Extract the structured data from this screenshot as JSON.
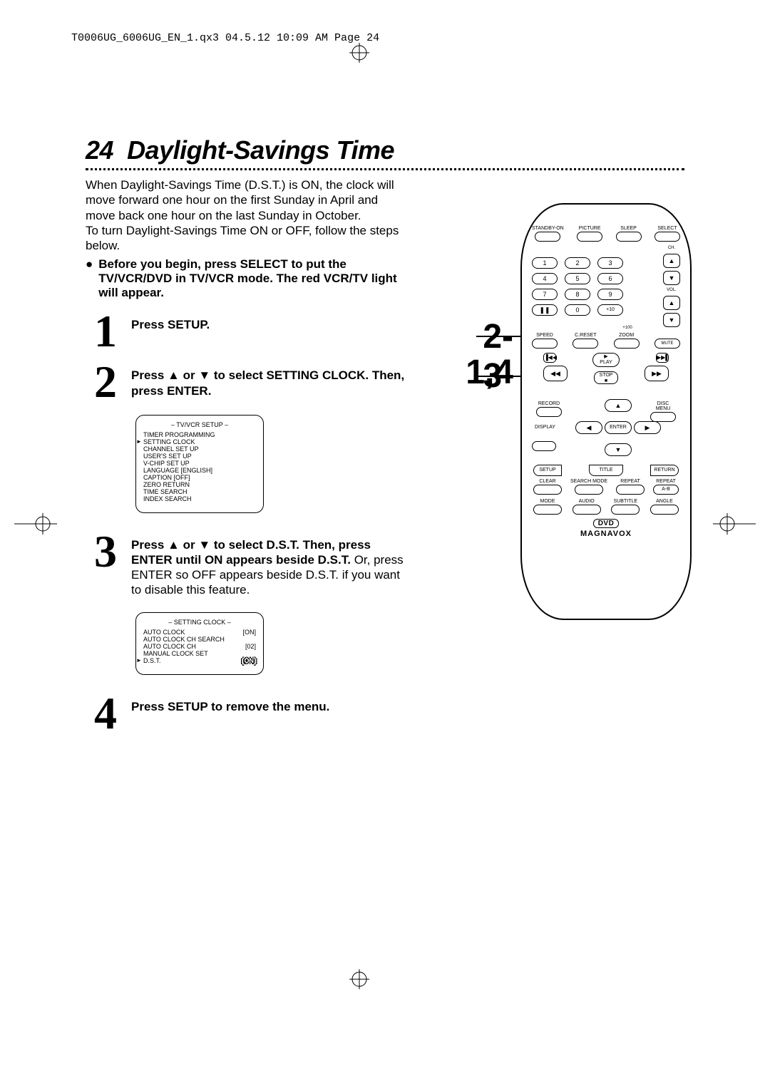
{
  "header": "T0006UG_6006UG_EN_1.qx3  04.5.12  10:09 AM  Page 24",
  "page_number": "24",
  "title": "Daylight-Savings Time",
  "intro": "When Daylight-Savings Time (D.S.T.) is ON, the clock will move forward one hour on the first Sunday in April and move back one hour on the last Sunday in October.\nTo turn Daylight-Savings Time ON or OFF, follow the steps below.",
  "bullet": "Before you begin, press SELECT to put the TV/VCR/DVD in TV/VCR mode. The red VCR/TV light will appear.",
  "steps": {
    "s1": {
      "num": "1",
      "body_bold": "Press SETUP."
    },
    "s2": {
      "num": "2",
      "body_bold": "Press ▲ or ▼ to select SETTING CLOCK. Then, press ENTER."
    },
    "s3": {
      "num": "3",
      "body_bold": "Press ▲ or ▼ to select D.S.T. Then, press ENTER until ON appears beside D.S.T. ",
      "body_rest": "Or, press ENTER so OFF appears beside D.S.T. if you want to disable this feature."
    },
    "s4": {
      "num": "4",
      "body_bold": "Press SETUP to remove the menu."
    }
  },
  "osd1": {
    "title": "– TV/VCR SETUP –",
    "items": [
      "TIMER PROGRAMMING",
      "SETTING CLOCK",
      "CHANNEL SET UP",
      "USER'S SET UP",
      "V-CHIP SET UP",
      "LANGUAGE   [ENGLISH]",
      "CAPTION   [OFF]",
      "ZERO RETURN",
      "TIME SEARCH",
      "INDEX SEARCH"
    ],
    "pointer_index": 1
  },
  "osd2": {
    "title": "– SETTING CLOCK –",
    "rows": [
      {
        "l": "AUTO CLOCK",
        "r": "[ON]"
      },
      {
        "l": "AUTO CLOCK CH SEARCH",
        "r": ""
      },
      {
        "l": "AUTO CLOCK CH",
        "r": "[02]"
      },
      {
        "l": "MANUAL CLOCK SET",
        "r": ""
      },
      {
        "l": "D.S.T.",
        "r": "[ON]"
      }
    ],
    "pointer_index": 4
  },
  "callouts": {
    "top": "2-3",
    "bot": "1,4"
  },
  "remote": {
    "row1": [
      "STANDBY-ON",
      "PICTURE",
      "SLEEP",
      "SELECT"
    ],
    "nums": [
      "1",
      "2",
      "3",
      "4",
      "5",
      "6",
      "7",
      "8",
      "9",
      "",
      "0",
      "+10"
    ],
    "pause_label": "❚❚",
    "plus100": "+100",
    "ch": "CH.",
    "vol": "VOL.",
    "row_speed": [
      "SPEED",
      "C.RESET",
      "ZOOM"
    ],
    "mute": "MUTE",
    "skip_back": "▐◀◀",
    "play": "▶\nPLAY",
    "skip_fwd": "▶▶▌",
    "rew": "◀◀",
    "ffwd": "▶▶",
    "stop": "STOP\n■",
    "record": "RECORD",
    "disc_menu": "DISC\nMENU",
    "up": "▲",
    "down": "▼",
    "left": "◀",
    "right": "▶",
    "enter": "ENTER",
    "display": "DISPLAY",
    "setup": "SETUP",
    "title": "TITLE",
    "return": "RETURN",
    "row_clear": [
      "CLEAR",
      "SEARCH MODE",
      "REPEAT",
      "REPEAT"
    ],
    "ab": "A-B",
    "row_mode": [
      "MODE",
      "AUDIO",
      "SUBTITLE",
      "ANGLE"
    ],
    "dvd": "DVD",
    "brand": "MAGNAVOX"
  }
}
